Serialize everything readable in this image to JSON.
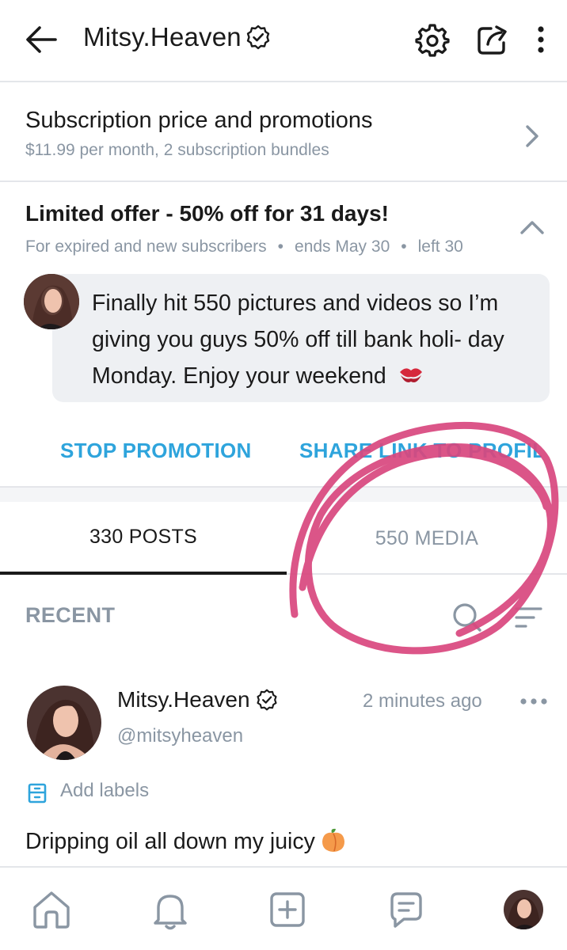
{
  "header": {
    "title": "Mitsy.Heaven",
    "back_icon": "arrow-left-icon",
    "verified_icon": "verified-badge-icon",
    "settings_icon": "gear-icon",
    "share_icon": "share-icon",
    "more_icon": "kebab-icon"
  },
  "subscription": {
    "title": "Subscription price and promotions",
    "description": "$11.99 per month, 2 subscription bundles"
  },
  "offer": {
    "title": "Limited offer - 50% off for 31 days!",
    "audience": "For expired and new subscribers",
    "ends": "ends May 30",
    "left": "left 30",
    "separator": "•",
    "message": "Finally hit 550 pictures and videos so I’m giving you guys 50% off till bank holi- day Monday. Enjoy your weekend",
    "message_emoji": "kiss-mark-icon"
  },
  "actions": {
    "stop_label": "STOP PROMOTION",
    "share_label": "SHARE LINK TO PROFILE"
  },
  "tabs": [
    {
      "label": "330 POSTS",
      "active": true
    },
    {
      "label": "550 MEDIA",
      "active": false
    }
  ],
  "feed": {
    "section_label": "RECENT"
  },
  "post": {
    "author": "Mitsy.Heaven",
    "handle": "@mitsyheaven",
    "time": "2 minutes ago",
    "labels_text": "Add labels",
    "text": "Dripping oil all down my juicy",
    "emoji": "peach-icon"
  },
  "bottom_nav": [
    "home-icon",
    "bell-icon",
    "add-post-icon",
    "messages-icon",
    "profile-avatar"
  ],
  "colors": {
    "accent": "#2ea4dc",
    "muted": "#8a96a3",
    "annotation": "#d9477e"
  }
}
